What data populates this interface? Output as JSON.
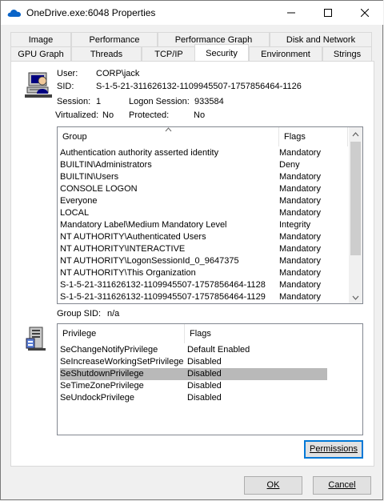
{
  "window": {
    "title": "OneDrive.exe:6048 Properties",
    "accent": "#0078d7"
  },
  "tabs_row1": [
    "Image",
    "Performance",
    "Performance Graph",
    "Disk and Network"
  ],
  "tabs_row2": [
    "GPU Graph",
    "Threads",
    "TCP/IP",
    "Security",
    "Environment",
    "Strings"
  ],
  "active_tab": "Security",
  "security": {
    "user_label": "User:",
    "user_value": "CORP\\jack",
    "sid_label": "SID:",
    "sid_value": "S-1-5-21-311626132-1109945507-1757856464-1126",
    "session_label": "Session:",
    "session_value": "1",
    "logon_label": "Logon Session:",
    "logon_value": "933584",
    "virtualized_label": "Virtualized:",
    "virtualized_value": "No",
    "protected_label": "Protected:",
    "protected_value": "No"
  },
  "groups": {
    "columns": [
      "Group",
      "Flags"
    ],
    "rows": [
      [
        "Authentication authority asserted identity",
        "Mandatory"
      ],
      [
        "BUILTIN\\Administrators",
        "Deny"
      ],
      [
        "BUILTIN\\Users",
        "Mandatory"
      ],
      [
        "CONSOLE LOGON",
        "Mandatory"
      ],
      [
        "Everyone",
        "Mandatory"
      ],
      [
        "LOCAL",
        "Mandatory"
      ],
      [
        "Mandatory Label\\Medium Mandatory Level",
        "Integrity"
      ],
      [
        "NT AUTHORITY\\Authenticated Users",
        "Mandatory"
      ],
      [
        "NT AUTHORITY\\INTERACTIVE",
        "Mandatory"
      ],
      [
        "NT AUTHORITY\\LogonSessionId_0_9647375",
        "Mandatory"
      ],
      [
        "NT AUTHORITY\\This Organization",
        "Mandatory"
      ],
      [
        "S-1-5-21-311626132-1109945507-1757856464-1128",
        "Mandatory"
      ],
      [
        "S-1-5-21-311626132-1109945507-1757856464-1129",
        "Mandatory"
      ]
    ]
  },
  "group_sid_label": "Group SID:",
  "group_sid_value": "n/a",
  "privileges": {
    "columns": [
      "Privilege",
      "Flags"
    ],
    "rows": [
      [
        "SeChangeNotifyPrivilege",
        "Default Enabled"
      ],
      [
        "SeIncreaseWorkingSetPrivilege",
        "Disabled"
      ],
      [
        "SeShutdownPrivilege",
        "Disabled"
      ],
      [
        "SeTimeZonePrivilege",
        "Disabled"
      ],
      [
        "SeUndockPrivilege",
        "Disabled"
      ]
    ],
    "selected_index": 2
  },
  "buttons": {
    "permissions": "Permissions",
    "ok": "OK",
    "cancel": "Cancel"
  }
}
